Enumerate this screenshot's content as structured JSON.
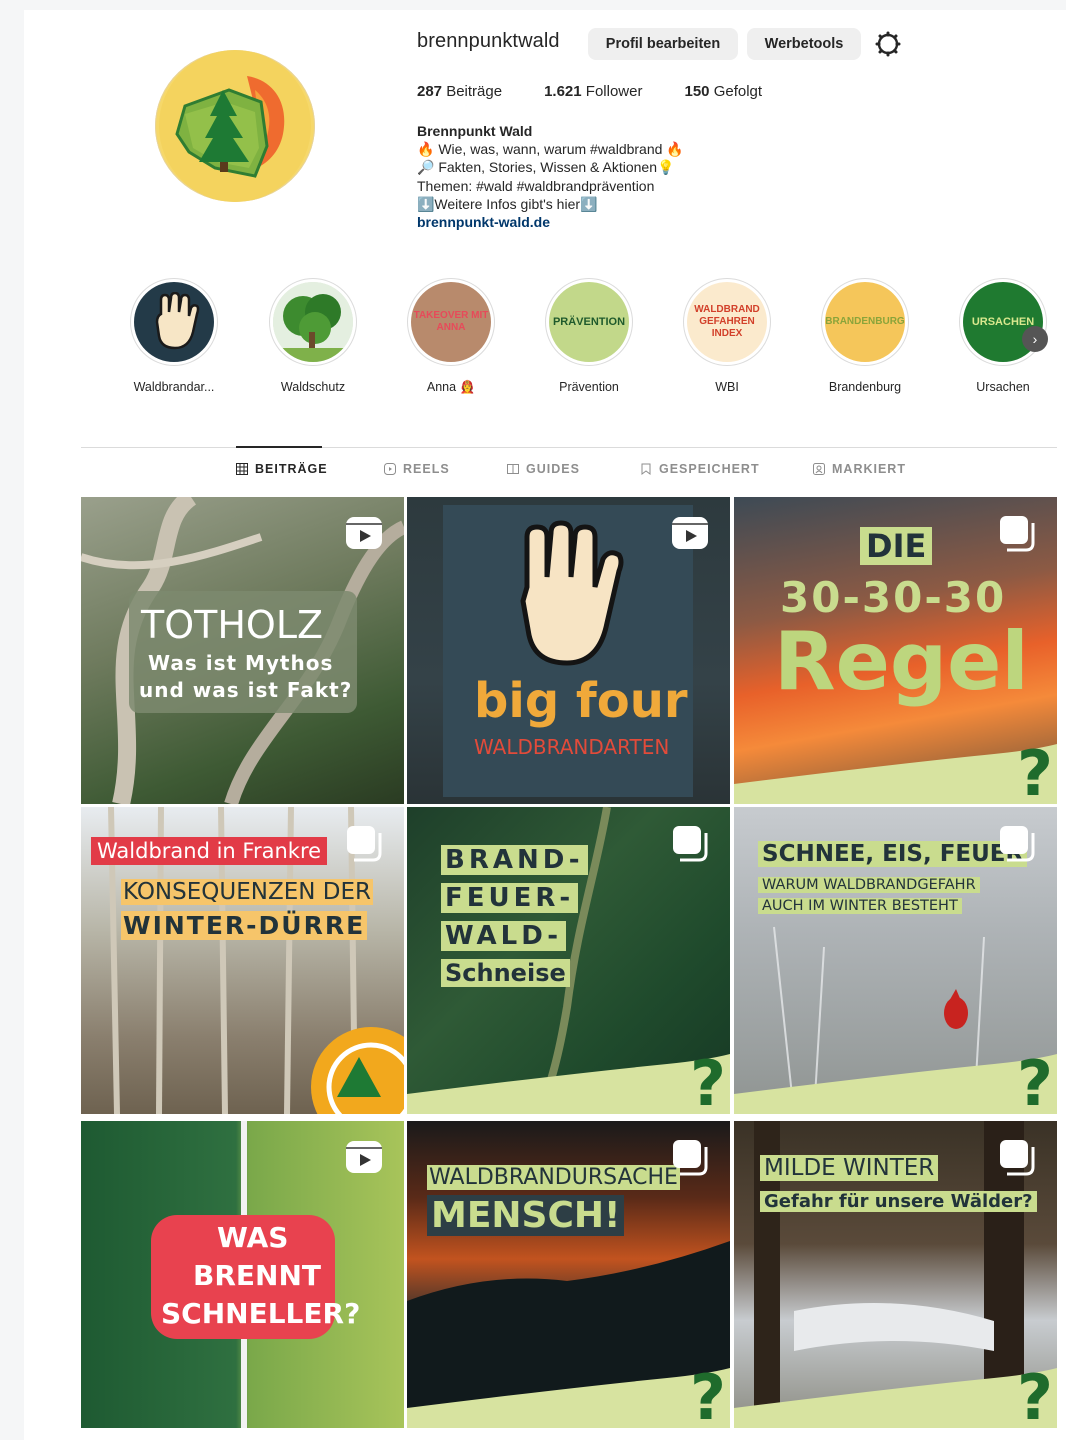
{
  "profile": {
    "username": "brennpunktwald",
    "edit_button": "Profil bearbeiten",
    "tools_button": "Werbetools",
    "stats": {
      "posts_count": "287",
      "posts_label": "Beiträge",
      "followers_count": "1.621",
      "followers_label": "Follower",
      "following_count": "150",
      "following_label": "Gefolgt"
    },
    "bio": {
      "name": "Brennpunkt Wald",
      "line1": "🔥 Wie, was, wann, warum #waldbrand 🔥",
      "line2": "🔎 Fakten, Stories, Wissen & Aktionen💡",
      "line3": "Themen: #wald #waldbrandprävention",
      "line4": "⬇️Weitere Infos gibt's hier⬇️",
      "link": "brennpunkt-wald.de"
    }
  },
  "highlights": [
    {
      "label": "Waldbrandar...",
      "icon": "hand-icon"
    },
    {
      "label": "Waldschutz",
      "icon": "trees-icon"
    },
    {
      "label": "Anna 👩‍🚒",
      "cover_text": "TAKEOVER MIT ANNA"
    },
    {
      "label": "Prävention",
      "cover_text": "PRÄVENTION"
    },
    {
      "label": "WBI",
      "cover_text": "WALDBRAND GEFAHREN INDEX"
    },
    {
      "label": "Brandenburg",
      "cover_text": "BRANDENBURG"
    },
    {
      "label": "Ursachen",
      "cover_text": "URSACHEN"
    }
  ],
  "tabs": [
    {
      "label": "BEITRÄGE",
      "icon": "grid-icon",
      "active": true
    },
    {
      "label": "REELS",
      "icon": "reels-icon",
      "active": false
    },
    {
      "label": "GUIDES",
      "icon": "guides-icon",
      "active": false
    },
    {
      "label": "GESPEICHERT",
      "icon": "bookmark-icon",
      "active": false
    },
    {
      "label": "MARKIERT",
      "icon": "tagged-icon",
      "active": false
    }
  ],
  "posts": [
    {
      "type": "reel",
      "title": "TOTHOLZ",
      "sub1": "Was ist Mythos",
      "sub2": "und was ist Fakt?"
    },
    {
      "type": "reel",
      "title": "big four",
      "sub1": "WALDBRANDARTEN"
    },
    {
      "type": "carousel",
      "title": "DIE",
      "sub1": "30-30-30",
      "sub2": "Regel"
    },
    {
      "type": "carousel",
      "title": "Waldbrand in Frankre",
      "sub1": "KONSEQUENZEN DER",
      "sub2": "WINTER-DÜRRE"
    },
    {
      "type": "carousel",
      "w1": "BRAND-",
      "w2": "FEUER-",
      "w3": "WALD-",
      "w4": "Schneise"
    },
    {
      "type": "carousel",
      "title": "SCHNEE, EIS, FEUER",
      "sub1": "WARUM WALDBRANDGEFAHR",
      "sub2": "AUCH IM WINTER BESTEHT"
    },
    {
      "type": "reel",
      "w1": "WAS",
      "w2": "BRENNT",
      "w3": "SCHNELLER?"
    },
    {
      "type": "carousel",
      "title": "WALDBRANDURSACHE",
      "sub1": "MENSCH!"
    },
    {
      "type": "carousel",
      "title": "MILDE WINTER",
      "sub1": "Gefahr für unsere Wälder?"
    }
  ],
  "qmark": "?",
  "colors": {
    "accent_green": "#1f6b2c",
    "link_blue": "#00376b",
    "pale_green": "#c8d98a"
  }
}
